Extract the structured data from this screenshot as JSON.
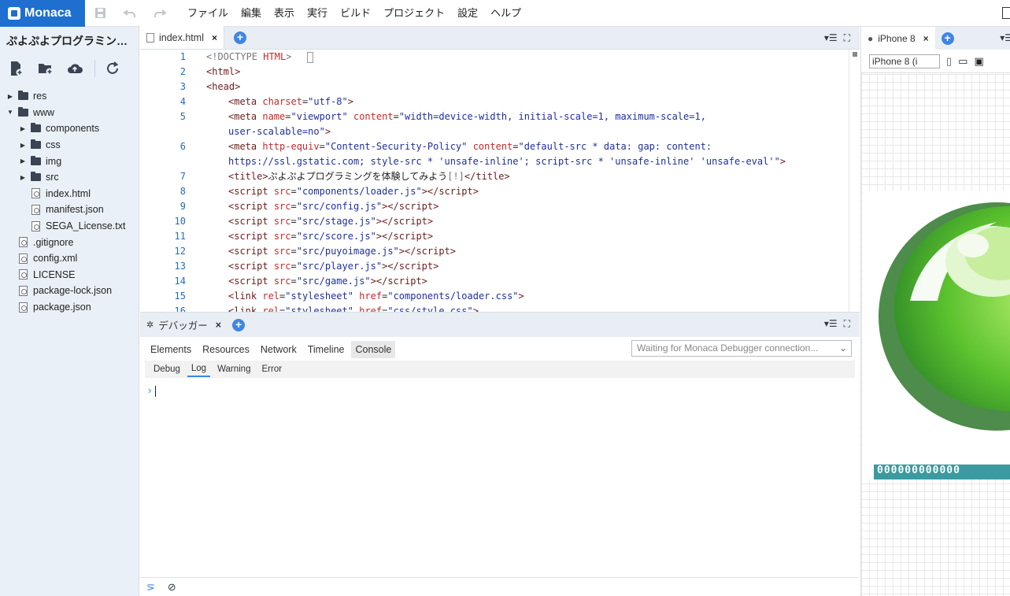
{
  "app": {
    "name": "Monaca"
  },
  "menu": [
    "ファイル",
    "編集",
    "表示",
    "実行",
    "ビルド",
    "プロジェクト",
    "設定",
    "ヘルプ"
  ],
  "sidebar": {
    "project_title": "ぷよぷよプログラミン…",
    "tree": [
      {
        "label": "res",
        "type": "folder",
        "level": 0,
        "expanded": false
      },
      {
        "label": "www",
        "type": "folder",
        "level": 0,
        "expanded": true
      },
      {
        "label": "components",
        "type": "jsfolder",
        "level": 1,
        "expanded": false
      },
      {
        "label": "css",
        "type": "folder",
        "level": 1,
        "expanded": false
      },
      {
        "label": "img",
        "type": "folder",
        "level": 1,
        "expanded": false
      },
      {
        "label": "src",
        "type": "folder",
        "level": 1,
        "expanded": false
      },
      {
        "label": "index.html",
        "type": "file",
        "level": 1
      },
      {
        "label": "manifest.json",
        "type": "file",
        "level": 1
      },
      {
        "label": "SEGA_License.txt",
        "type": "file",
        "level": 1
      },
      {
        "label": ".gitignore",
        "type": "file",
        "level": 0
      },
      {
        "label": "config.xml",
        "type": "file",
        "level": 0
      },
      {
        "label": "LICENSE",
        "type": "file",
        "level": 0
      },
      {
        "label": "package-lock.json",
        "type": "file",
        "level": 0
      },
      {
        "label": "package.json",
        "type": "file",
        "level": 0
      }
    ]
  },
  "editor": {
    "tab_label": "index.html",
    "lines": [
      {
        "n": "1",
        "html": "<span class='gray'>&lt;!</span><span class='gray'>DOCTYPE</span> <span class='attr'>HTML</span><span class='gray'>&gt;</span><span class='cursor-box'></span>",
        "indent": false
      },
      {
        "n": "2",
        "html": "<span class='tag'>&lt;html&gt;</span>",
        "indent": false
      },
      {
        "n": "3",
        "html": "<span class='tag'>&lt;head&gt;</span>",
        "indent": false
      },
      {
        "n": "4",
        "html": "<span class='tag'>&lt;meta</span> <span class='attr'>charset</span>=<span class='val'>\"utf-8\"</span><span class='tag'>&gt;</span>",
        "indent": true
      },
      {
        "n": "5",
        "html": "<span class='tag'>&lt;meta</span> <span class='attr'>name</span>=<span class='val'>\"viewport\"</span> <span class='attr'>content</span>=<span class='val'>\"width=device-width, initial-scale=1, maximum-scale=1,</span>",
        "indent": true
      },
      {
        "n": "",
        "html": "<span class='val'>user-scalable=no\"</span><span class='tag'>&gt;</span>",
        "indent": true
      },
      {
        "n": "6",
        "html": "<span class='tag'>&lt;meta</span> <span class='attr'>http-equiv</span>=<span class='val'>\"Content-Security-Policy\"</span> <span class='attr'>content</span>=<span class='val'>\"default-src * data: gap: content:</span>",
        "indent": true
      },
      {
        "n": "",
        "html": "<span class='val'>https://ssl.gstatic.com; style-src * 'unsafe-inline'; script-src * 'unsafe-inline' 'unsafe-eval'\"</span><span class='tag'>&gt;</span>",
        "indent": true
      },
      {
        "n": "7",
        "html": "<span class='tag'>&lt;title&gt;</span><span class='txt'>ぷよぷよプログラミングを体験してみよう</span><span class='gray'>[!]</span><span class='tag'>&lt;/title&gt;</span>",
        "indent": true
      },
      {
        "n": "8",
        "html": "<span class='tag'>&lt;script</span> <span class='attr'>src</span>=<span class='val'>\"components/loader.js\"</span><span class='tag'>&gt;&lt;/script&gt;</span>",
        "indent": true
      },
      {
        "n": "9",
        "html": "<span class='tag'>&lt;script</span> <span class='attr'>src</span>=<span class='val'>\"src/config.js\"</span><span class='tag'>&gt;&lt;/script&gt;</span>",
        "indent": true
      },
      {
        "n": "10",
        "html": "<span class='tag'>&lt;script</span> <span class='attr'>src</span>=<span class='val'>\"src/stage.js\"</span><span class='tag'>&gt;&lt;/script&gt;</span>",
        "indent": true
      },
      {
        "n": "11",
        "html": "<span class='tag'>&lt;script</span> <span class='attr'>src</span>=<span class='val'>\"src/score.js\"</span><span class='tag'>&gt;&lt;/script&gt;</span>",
        "indent": true
      },
      {
        "n": "12",
        "html": "<span class='tag'>&lt;script</span> <span class='attr'>src</span>=<span class='val'>\"src/puyoimage.js\"</span><span class='tag'>&gt;&lt;/script&gt;</span>",
        "indent": true
      },
      {
        "n": "13",
        "html": "<span class='tag'>&lt;script</span> <span class='attr'>src</span>=<span class='val'>\"src/player.js\"</span><span class='tag'>&gt;&lt;/script&gt;</span>",
        "indent": true
      },
      {
        "n": "14",
        "html": "<span class='tag'>&lt;script</span> <span class='attr'>src</span>=<span class='val'>\"src/game.js\"</span><span class='tag'>&gt;&lt;/script&gt;</span>",
        "indent": true
      },
      {
        "n": "15",
        "html": "<span class='tag'>&lt;link</span> <span class='attr'>rel</span>=<span class='val'>\"stylesheet\"</span> <span class='attr'>href</span>=<span class='val'>\"components/loader.css\"</span><span class='tag'>&gt;</span>",
        "indent": true
      },
      {
        "n": "16",
        "html": "<span class='tag'>&lt;link</span> <span class='attr'>rel</span>=<span class='val'>\"stylesheet\"</span> <span class='attr'>href</span>=<span class='val'>\"css/style.css\"</span><span class='tag'>&gt;</span>",
        "indent": true
      }
    ]
  },
  "debugger": {
    "tab_label": "デバッガー",
    "nav": [
      "Elements",
      "Resources",
      "Network",
      "Timeline",
      "Console"
    ],
    "active_nav": "Console",
    "connection_status": "Waiting for Monaca Debugger connection...",
    "levels": [
      "Debug",
      "Log",
      "Warning",
      "Error"
    ],
    "active_level": "Log"
  },
  "preview": {
    "tab_label": "iPhone 8",
    "device_select": "iPhone 8 (i",
    "score": "000000000000"
  }
}
